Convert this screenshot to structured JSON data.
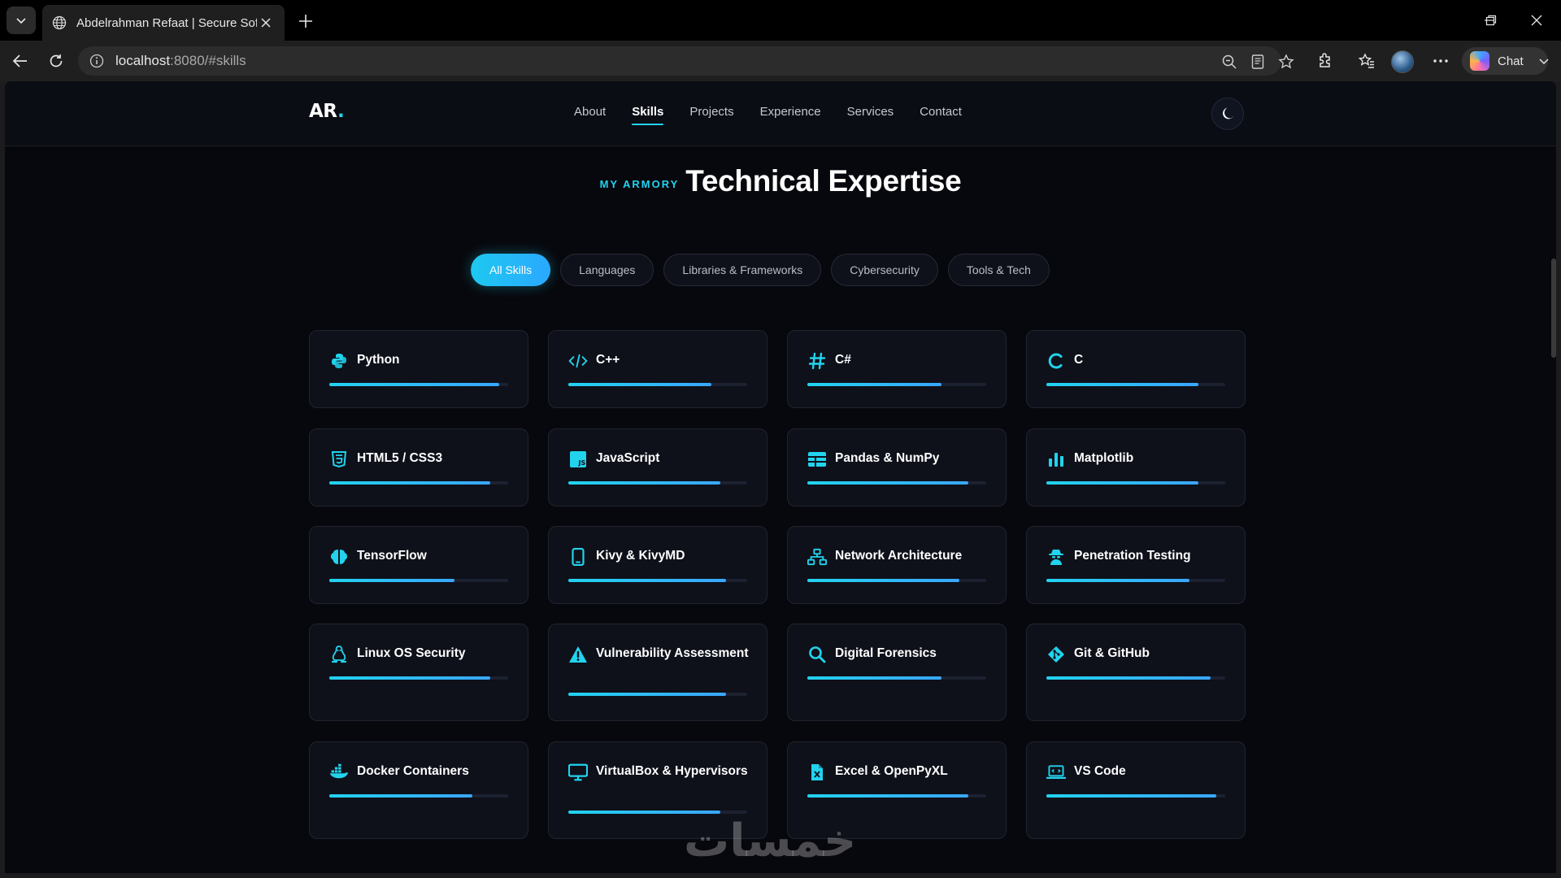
{
  "browser": {
    "tab_title": "Abdelrahman Refaat | Secure Softw",
    "url_host": "localhost",
    "url_path": ":8080/#skills",
    "chat_label": "Chat"
  },
  "site": {
    "logo": "AR",
    "logo_dot": ".",
    "nav": [
      "About",
      "Skills",
      "Projects",
      "Experience",
      "Services",
      "Contact"
    ],
    "active_nav": "Skills",
    "eyebrow": "MY ARMORY",
    "heading": "Technical Expertise",
    "filters": [
      "All Skills",
      "Languages",
      "Libraries & Frameworks",
      "Cybersecurity",
      "Tools & Tech"
    ],
    "active_filter": "All Skills",
    "accent_color": "#22d3ee",
    "watermark": "خمسات"
  },
  "skills": [
    {
      "name": "Python",
      "icon": "python-icon",
      "level": 0.95
    },
    {
      "name": "C++",
      "icon": "code-icon",
      "level": 0.8
    },
    {
      "name": "C#",
      "icon": "hashtag-icon",
      "level": 0.75
    },
    {
      "name": "C",
      "icon": "c-letter-icon",
      "level": 0.85
    },
    {
      "name": "HTML5 / CSS3",
      "icon": "html5-icon",
      "level": 0.9
    },
    {
      "name": "JavaScript",
      "icon": "js-icon",
      "level": 0.85
    },
    {
      "name": "Pandas & NumPy",
      "icon": "table-icon",
      "level": 0.9
    },
    {
      "name": "Matplotlib",
      "icon": "bar-chart-icon",
      "level": 0.85
    },
    {
      "name": "TensorFlow",
      "icon": "brain-icon",
      "level": 0.7
    },
    {
      "name": "Kivy & KivyMD",
      "icon": "mobile-icon",
      "level": 0.88
    },
    {
      "name": "Network Architecture",
      "icon": "network-icon",
      "level": 0.85
    },
    {
      "name": "Penetration Testing",
      "icon": "spy-icon",
      "level": 0.8
    },
    {
      "name": "Linux OS Security",
      "icon": "linux-icon",
      "level": 0.9
    },
    {
      "name": "Vulnerability Assessment",
      "icon": "warning-icon",
      "level": 0.88
    },
    {
      "name": "Digital Forensics",
      "icon": "search-icon",
      "level": 0.75
    },
    {
      "name": "Git & GitHub",
      "icon": "git-icon",
      "level": 0.92
    },
    {
      "name": "Docker Containers",
      "icon": "docker-icon",
      "level": 0.8
    },
    {
      "name": "VirtualBox & Hypervisors",
      "icon": "desktop-icon",
      "level": 0.85
    },
    {
      "name": "Excel & OpenPyXL",
      "icon": "excel-file-icon",
      "level": 0.9
    },
    {
      "name": "VS Code",
      "icon": "laptop-code-icon",
      "level": 0.95
    }
  ]
}
